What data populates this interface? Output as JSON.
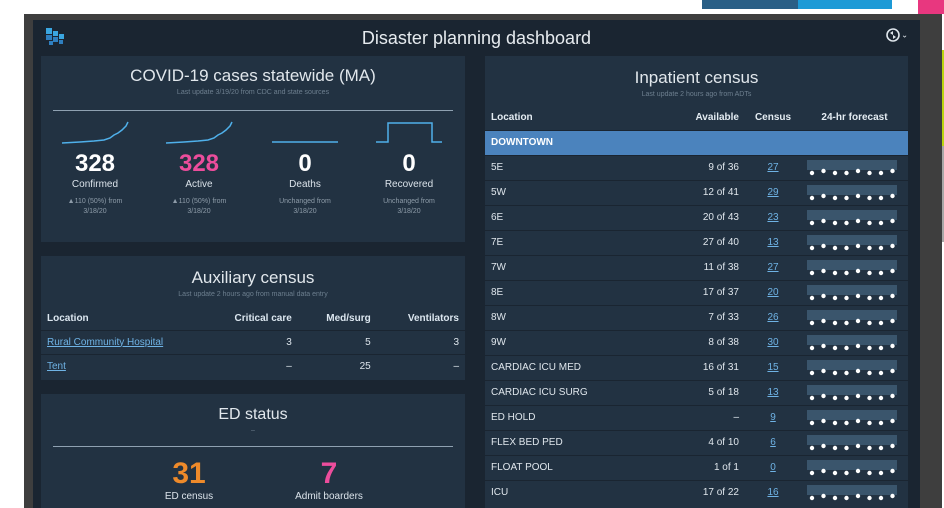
{
  "header": {
    "title": "Disaster planning dashboard"
  },
  "covid": {
    "title": "COVID-19 cases statewide (MA)",
    "subtitle": "Last update 3/19/20 from CDC and state sources",
    "metrics": [
      {
        "value": "328",
        "label": "Confirmed",
        "change": "▲110 (50%) from 3/18/20",
        "color": "#ffffff"
      },
      {
        "value": "328",
        "label": "Active",
        "change": "▲110 (50%) from 3/18/20",
        "color": "#ec4d9c"
      },
      {
        "value": "0",
        "label": "Deaths",
        "change": "Unchanged from 3/18/20",
        "color": "#ffffff"
      },
      {
        "value": "0",
        "label": "Recovered",
        "change": "Unchanged from 3/18/20",
        "color": "#ffffff"
      }
    ]
  },
  "aux": {
    "title": "Auxiliary census",
    "subtitle": "Last update 2 hours ago from manual data entry",
    "columns": [
      "Location",
      "Critical care",
      "Med/surg",
      "Ventilators"
    ],
    "rows": [
      {
        "location": "Rural Community Hospital",
        "critical": "3",
        "medsurg": "5",
        "vent": "3"
      },
      {
        "location": "Tent",
        "critical": "–",
        "medsurg": "25",
        "vent": "–"
      }
    ]
  },
  "ed": {
    "title": "ED status",
    "subtitle": "–",
    "census_value": "31",
    "census_label": "ED census",
    "boarders_value": "7",
    "boarders_label": "Admit boarders",
    "census_color": "#ee8a2a",
    "boarders_color": "#ec4d9c"
  },
  "inpatient": {
    "title": "Inpatient census",
    "subtitle": "Last update 2 hours ago from ADTs",
    "columns": [
      "Location",
      "Available",
      "Census",
      "24-hr forecast"
    ],
    "group": "DOWNTOWN",
    "rows": [
      {
        "location": "5E",
        "available": "9 of 36",
        "census": "27"
      },
      {
        "location": "5W",
        "available": "12 of 41",
        "census": "29"
      },
      {
        "location": "6E",
        "available": "20 of 43",
        "census": "23"
      },
      {
        "location": "7E",
        "available": "27 of 40",
        "census": "13"
      },
      {
        "location": "7W",
        "available": "11 of 38",
        "census": "27"
      },
      {
        "location": "8E",
        "available": "17 of 37",
        "census": "20"
      },
      {
        "location": "8W",
        "available": "7 of 33",
        "census": "26"
      },
      {
        "location": "9W",
        "available": "8 of 38",
        "census": "30"
      },
      {
        "location": "CARDIAC ICU MED",
        "available": "16 of 31",
        "census": "15"
      },
      {
        "location": "CARDIAC ICU SURG",
        "available": "5 of 18",
        "census": "13"
      },
      {
        "location": "ED HOLD",
        "available": "–",
        "census": "9"
      },
      {
        "location": "FLEX BED PED",
        "available": "4 of 10",
        "census": "6"
      },
      {
        "location": "FLOAT POOL",
        "available": "1 of 1",
        "census": "0"
      },
      {
        "location": "ICU",
        "available": "17 of 22",
        "census": "16"
      }
    ]
  }
}
